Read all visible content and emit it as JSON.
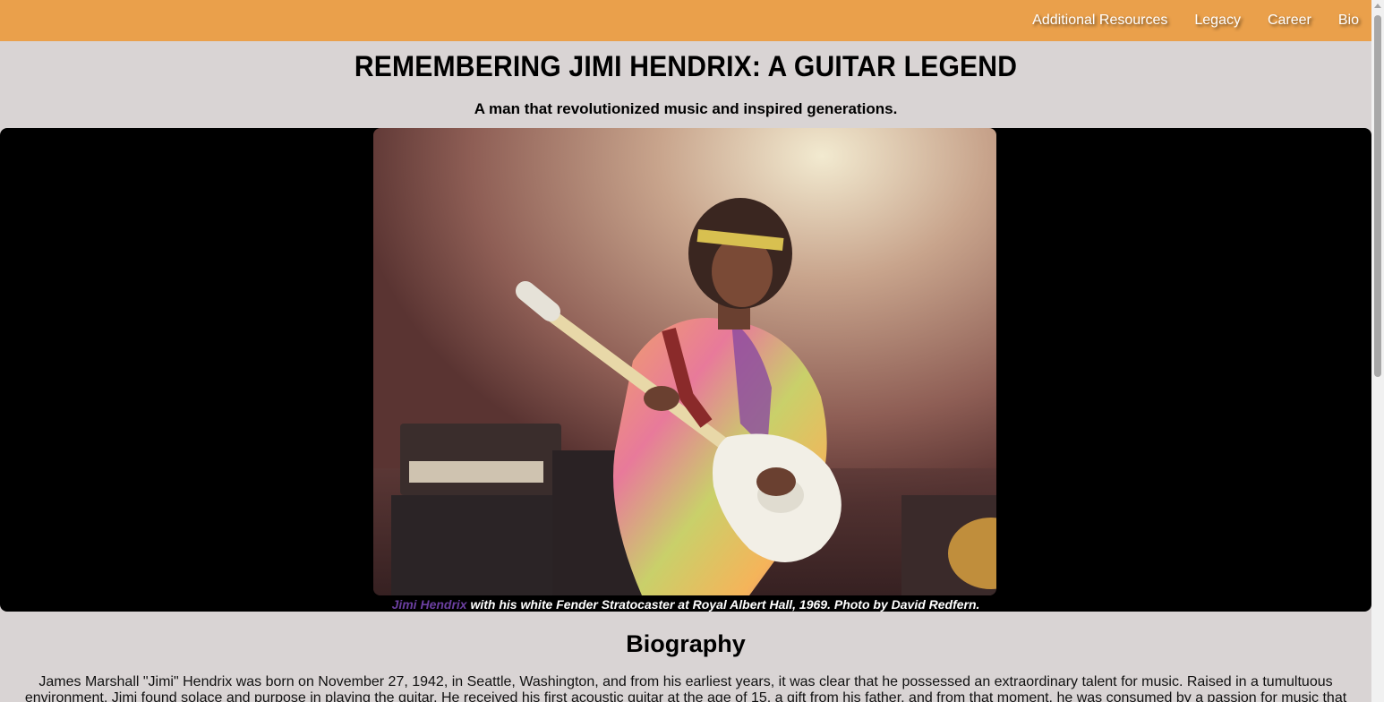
{
  "nav": {
    "items": [
      {
        "label": "Additional Resources"
      },
      {
        "label": "Legacy"
      },
      {
        "label": "Career"
      },
      {
        "label": "Bio"
      }
    ]
  },
  "header": {
    "title": "REMEMBERING JIMI HENDRIX: A GUITAR LEGEND",
    "subtitle": "A man that revolutionized music and inspired generations."
  },
  "hero": {
    "caption_link": "Jimi Hendrix",
    "caption_rest": " with his white Fender Stratocaster at Royal Albert Hall, 1969. Photo by David Redfern."
  },
  "biography": {
    "heading": "Biography",
    "text": "James Marshall \"Jimi\" Hendrix was born on November 27, 1942, in Seattle, Washington, and from his earliest years, it was clear that he possessed an extraordinary talent for music. Raised in a tumultuous environment, Jimi found solace and purpose in playing the guitar. He received his first acoustic guitar at the age of 15, a gift from his father, and from that moment, he was consumed by a passion for music that"
  },
  "colors": {
    "navbar": "#eaa04b",
    "page_background": "#d9d4d4",
    "hero_background": "#000000",
    "caption_link": "#6b3fa0"
  }
}
